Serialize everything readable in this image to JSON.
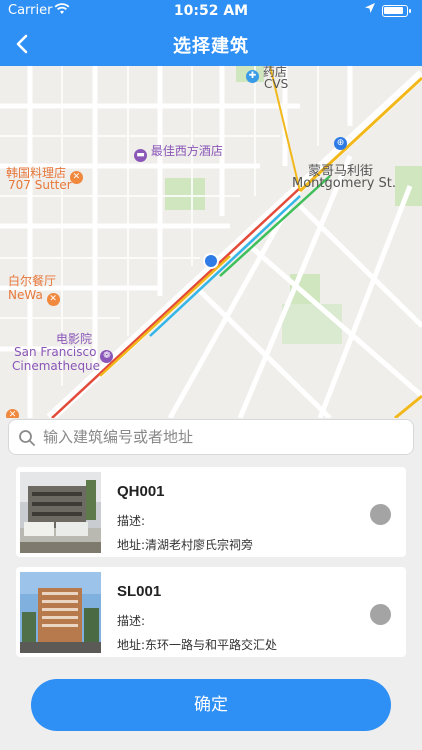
{
  "status_bar": {
    "carrier": "Carrier",
    "time": "10:52 AM"
  },
  "header": {
    "title": "选择建筑"
  },
  "map": {
    "labels": {
      "pharmacy": "药店",
      "cvs": "CVS",
      "hotel": "最佳西方酒店",
      "korean_cn": "韩国料理店",
      "korean_en": "707 Sutter",
      "metro_cn": "蒙哥马利街",
      "metro_en": "Montgomery St.",
      "newa_cn": "白尔餐厅",
      "newa_en": "NeWa",
      "cinema_cn": "电影院",
      "cinema_en1": "San Francisco",
      "cinema_en2": "Cinematheque"
    }
  },
  "search": {
    "placeholder": "输入建筑编号或者地址",
    "value": ""
  },
  "buildings": [
    {
      "code": "QH001",
      "description": "描述:",
      "address": "地址:清湖老村廖氏宗祠旁"
    },
    {
      "code": "SL001",
      "description": "描述:",
      "address": "地址:东环一路与和平路交汇处"
    }
  ],
  "actions": {
    "confirm_label": "确定"
  },
  "colors": {
    "brand": "#2e8ff5",
    "radio_off": "#a4a4a4"
  }
}
